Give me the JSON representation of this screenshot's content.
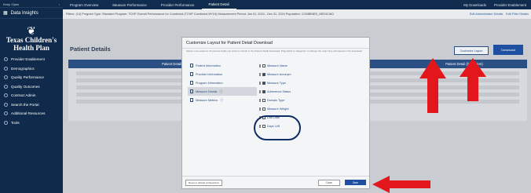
{
  "sidebar": {
    "top_left": "Keep Open",
    "app_title": "Data Insights",
    "logo_line1": "Texas Children's",
    "logo_line2": "Health Plan",
    "items": [
      {
        "label": "Provider Enablement"
      },
      {
        "label": "Demographics"
      },
      {
        "label": "Quality Performance"
      },
      {
        "label": "Quality Outcomes"
      },
      {
        "label": "Contract Admin"
      },
      {
        "label": "Search the Portal"
      },
      {
        "label": "Additional Resources"
      },
      {
        "label": "Tools"
      }
    ]
  },
  "topnav": {
    "tabs": [
      "Program Overview",
      "Measure Performance",
      "Provider Performance",
      "Patient Detail"
    ],
    "active_tab": "Patient Detail",
    "right_items": [
      "My Downloads",
      "Provider Enablement"
    ]
  },
  "filters": {
    "text": "Filters: (14)   Program Type: Standard   Program: TCHP Overall Performance for Combined (TCHP Combined MY24)   Measurement Period: Jan 01, 2024 - Dec 31, 2024   Population: COMBINED_MEDICAID",
    "link1": "Edit Administrator Details",
    "link2": "Edit Filter Details"
  },
  "page": {
    "title": "Patient Details",
    "customize_label": "Customize Layout",
    "download_label": "Download",
    "col_left_header": "Patient Detail",
    "col_right_header": "Patient Detail (by Patient)"
  },
  "modal": {
    "title": "Customize Layout for Patient Detail Download",
    "description": "Select or de-select to choose the fields you want to include in the Patient Detail Download. Drag fields to categorize to change the order they will appear in the download.",
    "categories": [
      {
        "label": "Patient Information"
      },
      {
        "label": "Provider Information"
      },
      {
        "label": "Program Information"
      },
      {
        "label": "Measure Details"
      },
      {
        "label": "Measure Metrics"
      }
    ],
    "fields": [
      {
        "label": "Measure Name"
      },
      {
        "label": "Measure Acronym"
      },
      {
        "label": "Measure Type"
      },
      {
        "label": "Adherence Status"
      },
      {
        "label": "Domain Type"
      },
      {
        "label": "Measure Weight"
      },
      {
        "label": "Due Date"
      },
      {
        "label": "Days Left"
      }
    ],
    "reset_label": "Reset to default configuration",
    "close_label": "Close",
    "save_label": "Save"
  },
  "colors": {
    "sidebar_bg": "#0f2a4a",
    "accent": "#1e4fa0",
    "highlight_arrow": "#e3161b",
    "highlight_circle": "#0e2d62"
  }
}
